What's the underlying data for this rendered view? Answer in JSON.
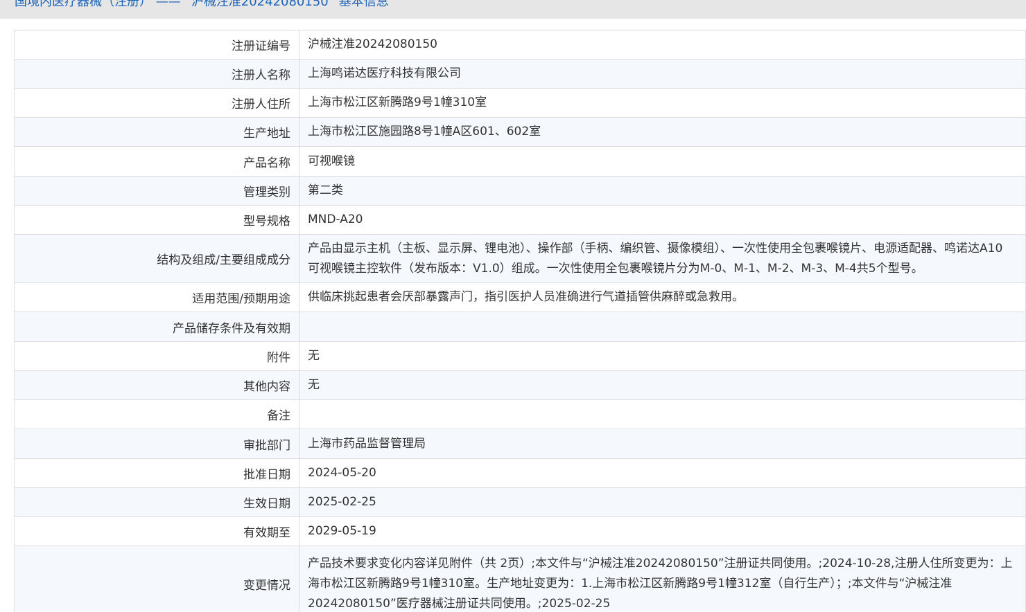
{
  "header": {
    "title": "国境内医疗器械（注册） —— “沪械注准20242080150” 基本信息"
  },
  "rows": [
    {
      "label": "注册证编号",
      "value": "沪械注准20242080150"
    },
    {
      "label": "注册人名称",
      "value": "上海鸣诺达医疗科技有限公司"
    },
    {
      "label": "注册人住所",
      "value": "上海市松江区新腾路9号1幢310室"
    },
    {
      "label": "生产地址",
      "value": "上海市松江区施园路8号1幢A区601、602室"
    },
    {
      "label": "产品名称",
      "value": "可视喉镜"
    },
    {
      "label": "管理类别",
      "value": "第二类"
    },
    {
      "label": "型号规格",
      "value": "MND-A20"
    },
    {
      "label": "结构及组成/主要组成成分",
      "value": "产品由显示主机（主板、显示屏、锂电池）、操作部（手柄、编织管、摄像模组）、一次性使用全包裹喉镜片、电源适配器、鸣诺达A10可视喉镜主控软件（发布版本：V1.0）组成。一次性使用全包裹喉镜片分为M-0、M-1、M-2、M-3、M-4共5个型号。"
    },
    {
      "label": "适用范围/预期用途",
      "value": "供临床挑起患者会厌部暴露声门，指引医护人员准确进行气道插管供麻醉或急救用。"
    },
    {
      "label": "产品储存条件及有效期",
      "value": ""
    },
    {
      "label": "附件",
      "value": "无"
    },
    {
      "label": "其他内容",
      "value": "无"
    },
    {
      "label": "备注",
      "value": ""
    },
    {
      "label": "审批部门",
      "value": "上海市药品监督管理局"
    },
    {
      "label": "批准日期",
      "value": "2024-05-20"
    },
    {
      "label": "生效日期",
      "value": "2025-02-25"
    },
    {
      "label": "有效期至",
      "value": "2029-05-19"
    },
    {
      "label": "变更情况",
      "value": "产品技术要求变化内容详见附件（共 2页）;本文件与“沪械注准20242080150”注册证共同使用。;2024-10-28,注册人住所变更为：上海市松江区新腾路9号1幢310室。生产地址变更为：1.上海市松江区新腾路9号1幢312室（自行生产）；;本文件与“沪械注准20242080150”医疗器械注册证共同使用。;2025-02-25"
    }
  ]
}
